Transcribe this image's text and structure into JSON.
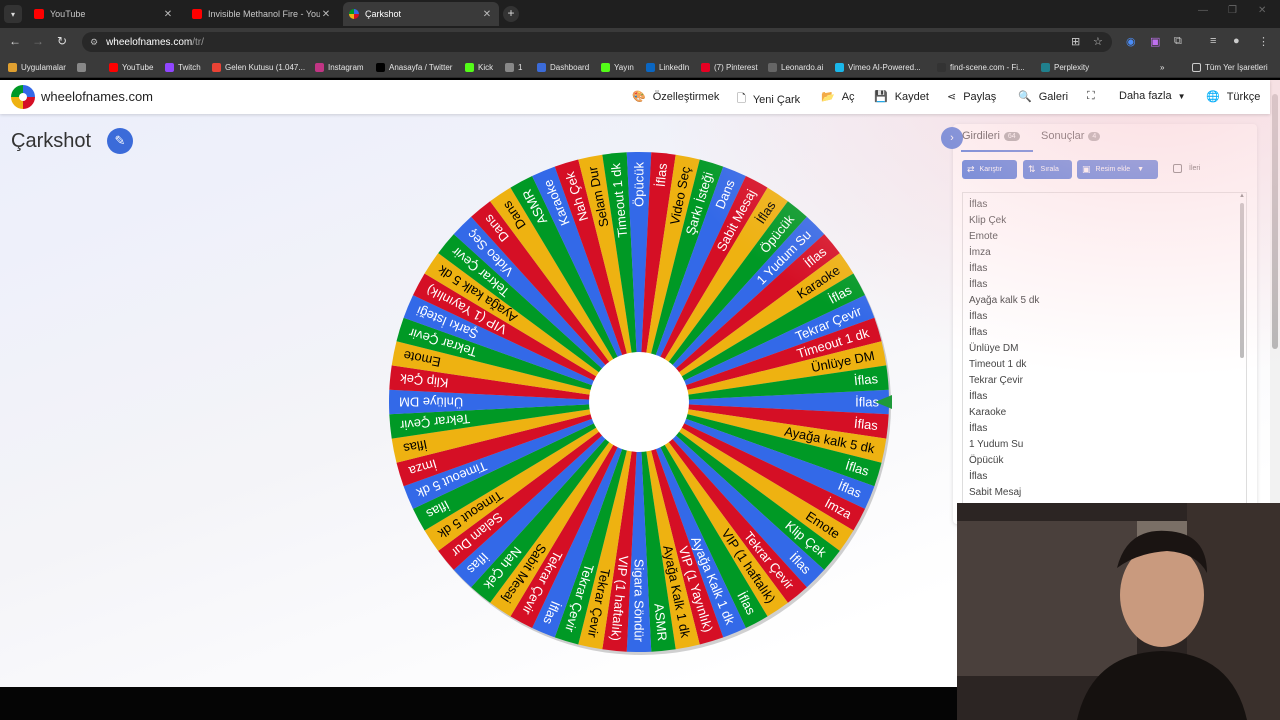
{
  "browser": {
    "tabs": [
      {
        "title": "YouTube",
        "favicon_color": "#ff0000",
        "active": false
      },
      {
        "title": "Invisible Methanol Fire - YouTube",
        "favicon_color": "#ff0000",
        "active": false
      },
      {
        "title": "Çarkshot",
        "favicon_color": "#4a8cf7",
        "active": true
      }
    ],
    "url_domain": "wheelofnames.com",
    "url_path": "/tr/",
    "bookmarks": [
      {
        "label": "Uygulamalar",
        "icon": "apps-grid-icon",
        "color": "#e0a030"
      },
      {
        "label": "",
        "icon": "grid-icon",
        "color": "#888888"
      },
      {
        "label": "YouTube",
        "icon": "youtube-icon",
        "color": "#ff0000"
      },
      {
        "label": "Twitch",
        "icon": "twitch-icon",
        "color": "#9146ff"
      },
      {
        "label": "Gelen Kutusu (1.047...",
        "icon": "gmail-icon",
        "color": "#ea4335"
      },
      {
        "label": "Instagram",
        "icon": "instagram-icon",
        "color": "#c13584"
      },
      {
        "label": "Anasayfa / Twitter",
        "icon": "x-icon",
        "color": "#000000"
      },
      {
        "label": "Kick",
        "icon": "kick-icon",
        "color": "#53fc18"
      },
      {
        "label": "1",
        "icon": "folder-icon",
        "color": "#888888"
      },
      {
        "label": "Dashboard",
        "icon": "dashboard-icon",
        "color": "#3b6bd9"
      },
      {
        "label": "Yayın",
        "icon": "kick-icon",
        "color": "#53fc18"
      },
      {
        "label": "LinkedIn",
        "icon": "linkedin-icon",
        "color": "#0a66c2"
      },
      {
        "label": "(7) Pinterest",
        "icon": "pinterest-icon",
        "color": "#e60023"
      },
      {
        "label": "Leonardo.ai",
        "icon": "leonardo-icon",
        "color": "#666666"
      },
      {
        "label": "Vimeo AI-Powered...",
        "icon": "vimeo-icon",
        "color": "#1ab7ea"
      },
      {
        "label": "find-scene.com - Fi...",
        "icon": "findscene-icon",
        "color": "#333333"
      },
      {
        "label": "Perplexity",
        "icon": "perplexity-icon",
        "color": "#20808d"
      }
    ],
    "bookmarks_overflow": "»",
    "all_bookmarks": "Tüm Yer İşaretleri"
  },
  "site": {
    "name": "wheelofnames.com",
    "menu": [
      "Özelleştirmek",
      "Yeni Çark",
      "Aç",
      "Kaydet",
      "Paylaş",
      "Galeri",
      "",
      "Daha fazla",
      "Türkçe"
    ]
  },
  "wheel_title": "Çarkshot",
  "panel": {
    "tab_entries": "Girdileri",
    "entries_count": "64",
    "tab_results": "Sonuçlar",
    "results_count": "4",
    "btn_shuffle": "Karıştır",
    "btn_sort": "Sırala",
    "btn_add_image": "Resim ekle",
    "advanced": "İleri",
    "entries": [
      "İflas",
      "Klip Çek",
      "Emote",
      "İmza",
      "İflas",
      "İflas",
      "Ayağa kalk 5 dk",
      "İflas",
      "İflas",
      "Ünlüye DM",
      "Timeout 1 dk",
      "Tekrar Çevir",
      "İflas",
      "Karaoke",
      "İflas",
      "1 Yudum Su",
      "Öpücük",
      "İflas",
      "Sabit Mesaj"
    ]
  },
  "wheel": {
    "colors": [
      "#3369e8",
      "#d50f25",
      "#eeb211",
      "#009925"
    ],
    "segments": [
      "İflas",
      "İflas",
      "Ayağa kalk 5 dk",
      "İflas",
      "İflas",
      "İmza",
      "Emote",
      "Klip Çek",
      "İflas",
      "Tekrar Çevir",
      "VIP (1 haftalık)",
      "İflas",
      "Ayağa Kalk 1 dk",
      "VIP (1 Yayınlık)",
      "Ayağa Kalk 1 dk",
      "ASMR",
      "Sigara Söndür",
      "VIP (1 haftalık)",
      "Tekrar Çevir",
      "Tekrar Çevir",
      "İflas",
      "Tekrar Çevir",
      "Sabit Mesaj",
      "Nah Çek",
      "İflas",
      "Selam Dur",
      "Timeout 5 dk",
      "İflas",
      "Timeout 5 dk",
      "İmza",
      "İflas",
      "Tekrar Çevir",
      "Ünlüye DM",
      "Klip Çek",
      "Emote",
      "Tekrar Çevir",
      "Şarkı İsteği",
      "VIP (1 Yayınlık)",
      "Ayağa kalk 5 dk",
      "Tekrar Çevir",
      "Video Seç",
      "Dans",
      "Dans",
      "ASMR",
      "Karaoke",
      "Nah Çek",
      "Selam Dur",
      "Timeout 1 dk",
      "Öpücük",
      "İflas",
      "Video Seç",
      "Şarkı İsteği",
      "Dans",
      "Sabit Mesaj",
      "İflas",
      "Öpücük",
      "1 Yudum Su",
      "İflas",
      "Karaoke",
      "İflas",
      "Tekrar Çevir",
      "Timeout 1 dk",
      "Ünlüye DM",
      "İflas"
    ]
  }
}
